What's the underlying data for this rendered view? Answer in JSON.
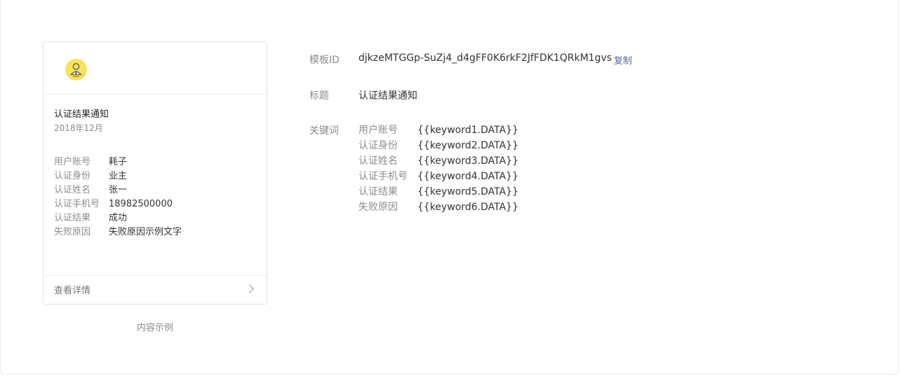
{
  "preview": {
    "title": "认证结果通知",
    "date": "2018年12月",
    "fields": [
      {
        "label": "用户账号",
        "value": "耗子"
      },
      {
        "label": "认证身份",
        "value": "业主"
      },
      {
        "label": "认证姓名",
        "value": "张一"
      },
      {
        "label": "认证手机号",
        "value": "18982500000"
      },
      {
        "label": "认证结果",
        "value": "成功"
      },
      {
        "label": "失败原因",
        "value": "失败原因示例文字"
      }
    ],
    "detail_label": "查看详情",
    "avatar_icon": "person-avatar-icon",
    "avatar_color": "#f7e35c"
  },
  "sample_caption": "内容示例",
  "template": {
    "id_label": "模板ID",
    "id_value": "djkzeMTGGp-SuZj4_d4gFF0K6rkF2JfFDK1QRkM1gvs",
    "copy_label": "复制",
    "title_label": "标题",
    "title_value": "认证结果通知",
    "keywords_label": "关键词",
    "keywords": [
      {
        "name": "用户账号",
        "placeholder": "{{keyword1.DATA}}"
      },
      {
        "name": "认证身份",
        "placeholder": "{{keyword2.DATA}}"
      },
      {
        "name": "认证姓名",
        "placeholder": "{{keyword3.DATA}}"
      },
      {
        "name": "认证手机号",
        "placeholder": "{{keyword4.DATA}}"
      },
      {
        "name": "认证结果",
        "placeholder": "{{keyword5.DATA}}"
      },
      {
        "name": "失败原因",
        "placeholder": "{{keyword6.DATA}}"
      }
    ],
    "link_color": "#576b95"
  }
}
